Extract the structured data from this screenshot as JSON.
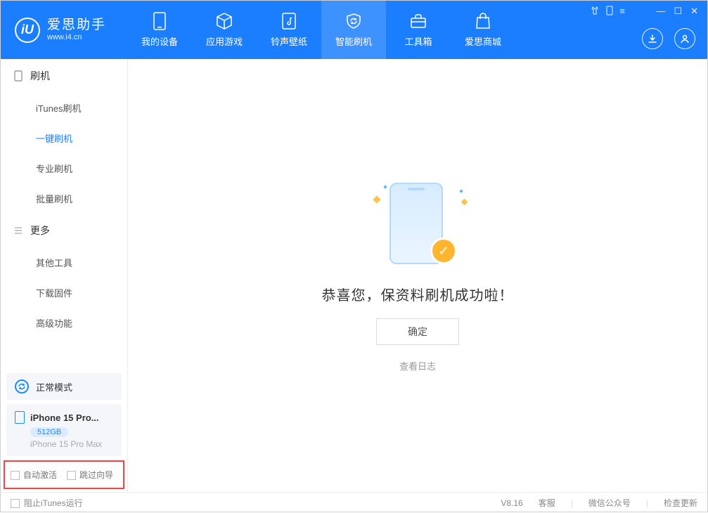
{
  "app": {
    "name": "爱思助手",
    "url": "www.i4.cn"
  },
  "nav": [
    {
      "label": "我的设备"
    },
    {
      "label": "应用游戏"
    },
    {
      "label": "铃声壁纸"
    },
    {
      "label": "智能刷机"
    },
    {
      "label": "工具箱"
    },
    {
      "label": "爱思商城"
    }
  ],
  "sidebar": {
    "section1": {
      "title": "刷机",
      "items": [
        {
          "label": "iTunes刷机"
        },
        {
          "label": "一键刷机"
        },
        {
          "label": "专业刷机"
        },
        {
          "label": "批量刷机"
        }
      ]
    },
    "section2": {
      "title": "更多",
      "items": [
        {
          "label": "其他工具"
        },
        {
          "label": "下载固件"
        },
        {
          "label": "高级功能"
        }
      ]
    }
  },
  "device": {
    "status": "正常模式",
    "name": "iPhone 15 Pro...",
    "storage": "512GB",
    "model": "iPhone 15 Pro Max"
  },
  "options": {
    "auto_activate": "自动激活",
    "skip_guide": "跳过向导"
  },
  "main": {
    "success": "恭喜您，保资料刷机成功啦！",
    "ok": "确定",
    "view_log": "查看日志"
  },
  "footer": {
    "block_itunes": "阻止iTunes运行",
    "version": "V8.16",
    "support": "客服",
    "wechat": "微信公众号",
    "check_update": "检查更新"
  }
}
